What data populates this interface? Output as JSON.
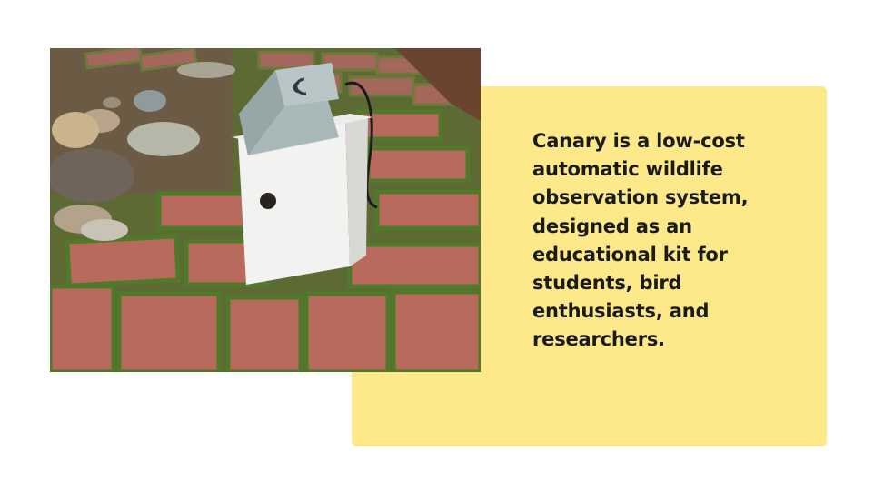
{
  "slide": {
    "caption": "Canary is a low-cost automatic wildlife observation system, designed as an educational kit for students, bird enthusiasts, and researchers."
  },
  "colors": {
    "card_background": "#fde98a",
    "text": "#1b1b1b",
    "brick": "#b86a5c",
    "moss": "#4f7a2a",
    "birdhouse": "#f2f2f0",
    "enclosure": "#a9b8b9"
  },
  "photo": {
    "description_icons": [
      "birdhouse-icon",
      "sensor-enclosure-icon",
      "canary-logo-icon"
    ]
  }
}
